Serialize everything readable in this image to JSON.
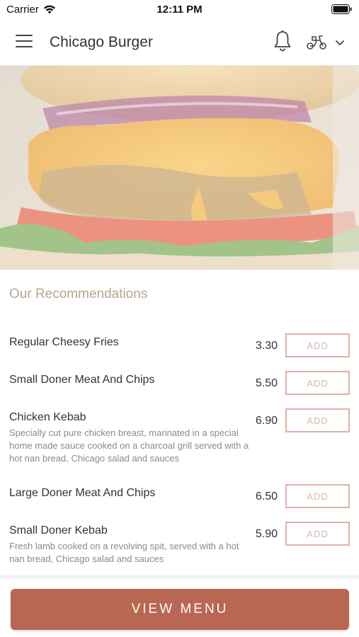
{
  "status_bar": {
    "carrier": "Carrier",
    "time": "12:11 PM"
  },
  "header": {
    "title": "Chicago Burger",
    "icons": [
      "menu-icon",
      "bell-icon",
      "scooter-icon",
      "chevron-down-icon"
    ]
  },
  "hero": {
    "image": "burger-photo"
  },
  "recommendations": {
    "title": "Our Recommendations",
    "add_label": "ADD",
    "items": [
      {
        "name": "Regular Cheesy Fries",
        "description": "",
        "price": "3.30"
      },
      {
        "name": "Small Doner Meat And Chips",
        "description": "",
        "price": "5.50"
      },
      {
        "name": "Chicken Kebab",
        "description": "Specially cut pure chicken breast, marinated in a special home made sauce cooked on a charcoal grill served with a hot nan bread, Chicago salad and sauces",
        "price": "6.90"
      },
      {
        "name": "Large Doner Meat And Chips",
        "description": "",
        "price": "6.50"
      },
      {
        "name": "Small Doner Kebab",
        "description": "Fresh lamb cooked on a revolving spit, served with a hot nan bread, Chicago salad and sauces",
        "price": "5.90"
      }
    ]
  },
  "footer": {
    "view_menu_label": "VIEW MENU"
  },
  "colors": {
    "accent": "#b86852",
    "section_title": "#b5a68c",
    "add_border": "#e3b0a7"
  }
}
